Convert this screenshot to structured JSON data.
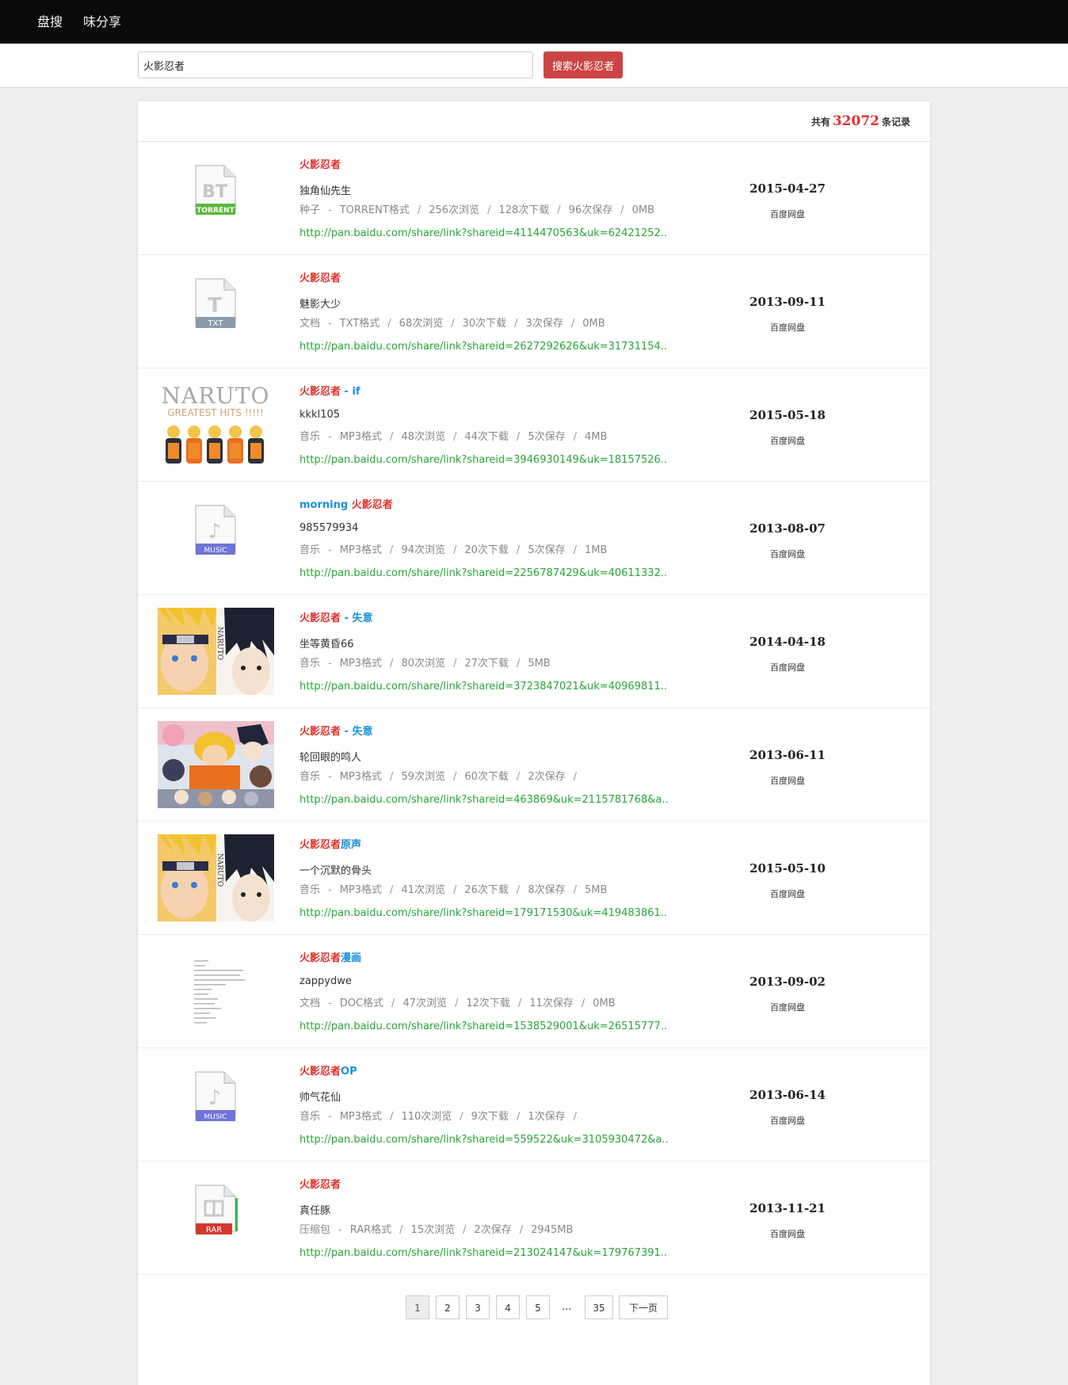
{
  "nav": {
    "brand": "盘搜",
    "share": "味分享"
  },
  "search": {
    "value": "火影忍者",
    "button_label": "搜索火影忍者"
  },
  "summary": {
    "prefix": "共有",
    "count": "32072",
    "suffix": "条记录"
  },
  "results": [
    {
      "thumb": "bt-torrent-icon",
      "thumb_label": "TORRENT",
      "title_parts": [
        {
          "text": "火影忍者",
          "hl": true
        }
      ],
      "uploader": "独角仙先生",
      "meta": [
        "种子",
        "TORRENT格式",
        "256次浏览",
        "128次下载",
        "96次保存",
        "0MB"
      ],
      "link": "http://pan.baidu.com/share/link?shareid=4114470563&uk=62421252..",
      "date": "2015-04-27",
      "source": "百度网盘"
    },
    {
      "thumb": "txt-file-icon",
      "thumb_label": "TXT",
      "title_parts": [
        {
          "text": "火影忍者",
          "hl": true
        }
      ],
      "uploader": "魅影大少",
      "meta": [
        "文档",
        "TXT格式",
        "68次浏览",
        "30次下载",
        "3次保存",
        "0MB"
      ],
      "link": "http://pan.baidu.com/share/link?shareid=2627292626&uk=31731154..",
      "date": "2013-09-11",
      "source": "百度网盘"
    },
    {
      "thumb": "naruto-album-cover",
      "thumb_label": "NARUTO",
      "thumb_sub": "GREATEST HITS !!!!!",
      "title_parts": [
        {
          "text": "火影忍者",
          "hl": true
        },
        {
          "text": " - if",
          "hl": false
        }
      ],
      "uploader": "kkkl105",
      "meta": [
        "音乐",
        "MP3格式",
        "48次浏览",
        "44次下载",
        "5次保存",
        "4MB"
      ],
      "link": "http://pan.baidu.com/share/link?shareid=3946930149&uk=18157526..",
      "date": "2015-05-18",
      "source": "百度网盘"
    },
    {
      "thumb": "music-file-icon",
      "thumb_label": "MUSIC",
      "title_parts": [
        {
          "text": "morning ",
          "hl": false
        },
        {
          "text": "火影忍者",
          "hl": true
        }
      ],
      "uploader": "985579934",
      "meta": [
        "音乐",
        "MP3格式",
        "94次浏览",
        "20次下载",
        "5次保存",
        "1MB"
      ],
      "link": "http://pan.baidu.com/share/link?shareid=2256787429&uk=40611332..",
      "date": "2013-08-07",
      "source": "百度网盘"
    },
    {
      "thumb": "naruto-sasuke-cover",
      "thumb_label": "NARUTO",
      "title_parts": [
        {
          "text": "火影忍者",
          "hl": true
        },
        {
          "text": " - 失意",
          "hl": false
        }
      ],
      "uploader": "坐等黄昏66",
      "meta": [
        "音乐",
        "MP3格式",
        "80次浏览",
        "27次下载",
        "5MB"
      ],
      "link": "http://pan.baidu.com/share/link?shareid=3723847021&uk=40969811..",
      "date": "2014-04-18",
      "source": "百度网盘"
    },
    {
      "thumb": "naruto-group-cover",
      "thumb_label": "",
      "title_parts": [
        {
          "text": "火影忍者",
          "hl": true
        },
        {
          "text": " - 失意",
          "hl": false
        }
      ],
      "uploader": "轮回眼的鸣人",
      "meta": [
        "音乐",
        "MP3格式",
        "59次浏览",
        "60次下载",
        "2次保存",
        ""
      ],
      "link": "http://pan.baidu.com/share/link?shareid=463869&uk=2115781768&a..",
      "date": "2013-06-11",
      "source": "百度网盘"
    },
    {
      "thumb": "naruto-sasuke-cover",
      "thumb_label": "NARUTO",
      "title_parts": [
        {
          "text": "火影忍者",
          "hl": true
        },
        {
          "text": "原声",
          "hl": false
        }
      ],
      "uploader": "一个沉默的骨头",
      "meta": [
        "音乐",
        "MP3格式",
        "41次浏览",
        "26次下载",
        "8次保存",
        "5MB"
      ],
      "link": "http://pan.baidu.com/share/link?shareid=179171530&uk=419483861..",
      "date": "2015-05-10",
      "source": "百度网盘"
    },
    {
      "thumb": "document-preview",
      "thumb_label": "",
      "title_parts": [
        {
          "text": "火影忍者",
          "hl": true
        },
        {
          "text": "漫画",
          "hl": false
        }
      ],
      "uploader": "zappydwe",
      "meta": [
        "文档",
        "DOC格式",
        "47次浏览",
        "12次下载",
        "11次保存",
        "0MB"
      ],
      "link": "http://pan.baidu.com/share/link?shareid=1538529001&uk=26515777..",
      "date": "2013-09-02",
      "source": "百度网盘"
    },
    {
      "thumb": "music-file-icon",
      "thumb_label": "MUSIC",
      "title_parts": [
        {
          "text": "火影忍者",
          "hl": true
        },
        {
          "text": "OP",
          "hl": false
        }
      ],
      "uploader": "帅气花仙",
      "meta": [
        "音乐",
        "MP3格式",
        "110次浏览",
        "9次下载",
        "1次保存",
        ""
      ],
      "link": "http://pan.baidu.com/share/link?shareid=559522&uk=3105930472&a..",
      "date": "2013-06-14",
      "source": "百度网盘"
    },
    {
      "thumb": "rar-archive-icon",
      "thumb_label": "RAR",
      "title_parts": [
        {
          "text": "火影忍者",
          "hl": true
        }
      ],
      "uploader": "真任豚",
      "meta": [
        "压缩包",
        "RAR格式",
        "15次浏览",
        "2次保存",
        "2945MB"
      ],
      "link": "http://pan.baidu.com/share/link?shareid=213024147&uk=179767391..",
      "date": "2013-11-21",
      "source": "百度网盘"
    }
  ],
  "pagination": {
    "pages": [
      "1",
      "2",
      "3",
      "4",
      "5"
    ],
    "ellipsis": "...",
    "last": "35",
    "next": "下一页",
    "current": "1"
  },
  "colors": {
    "topbar": "#0a0a0a",
    "search_button": "#cc4444",
    "highlight": "#e0302b",
    "extra": "#1a90d8",
    "link": "#2aa33a"
  }
}
